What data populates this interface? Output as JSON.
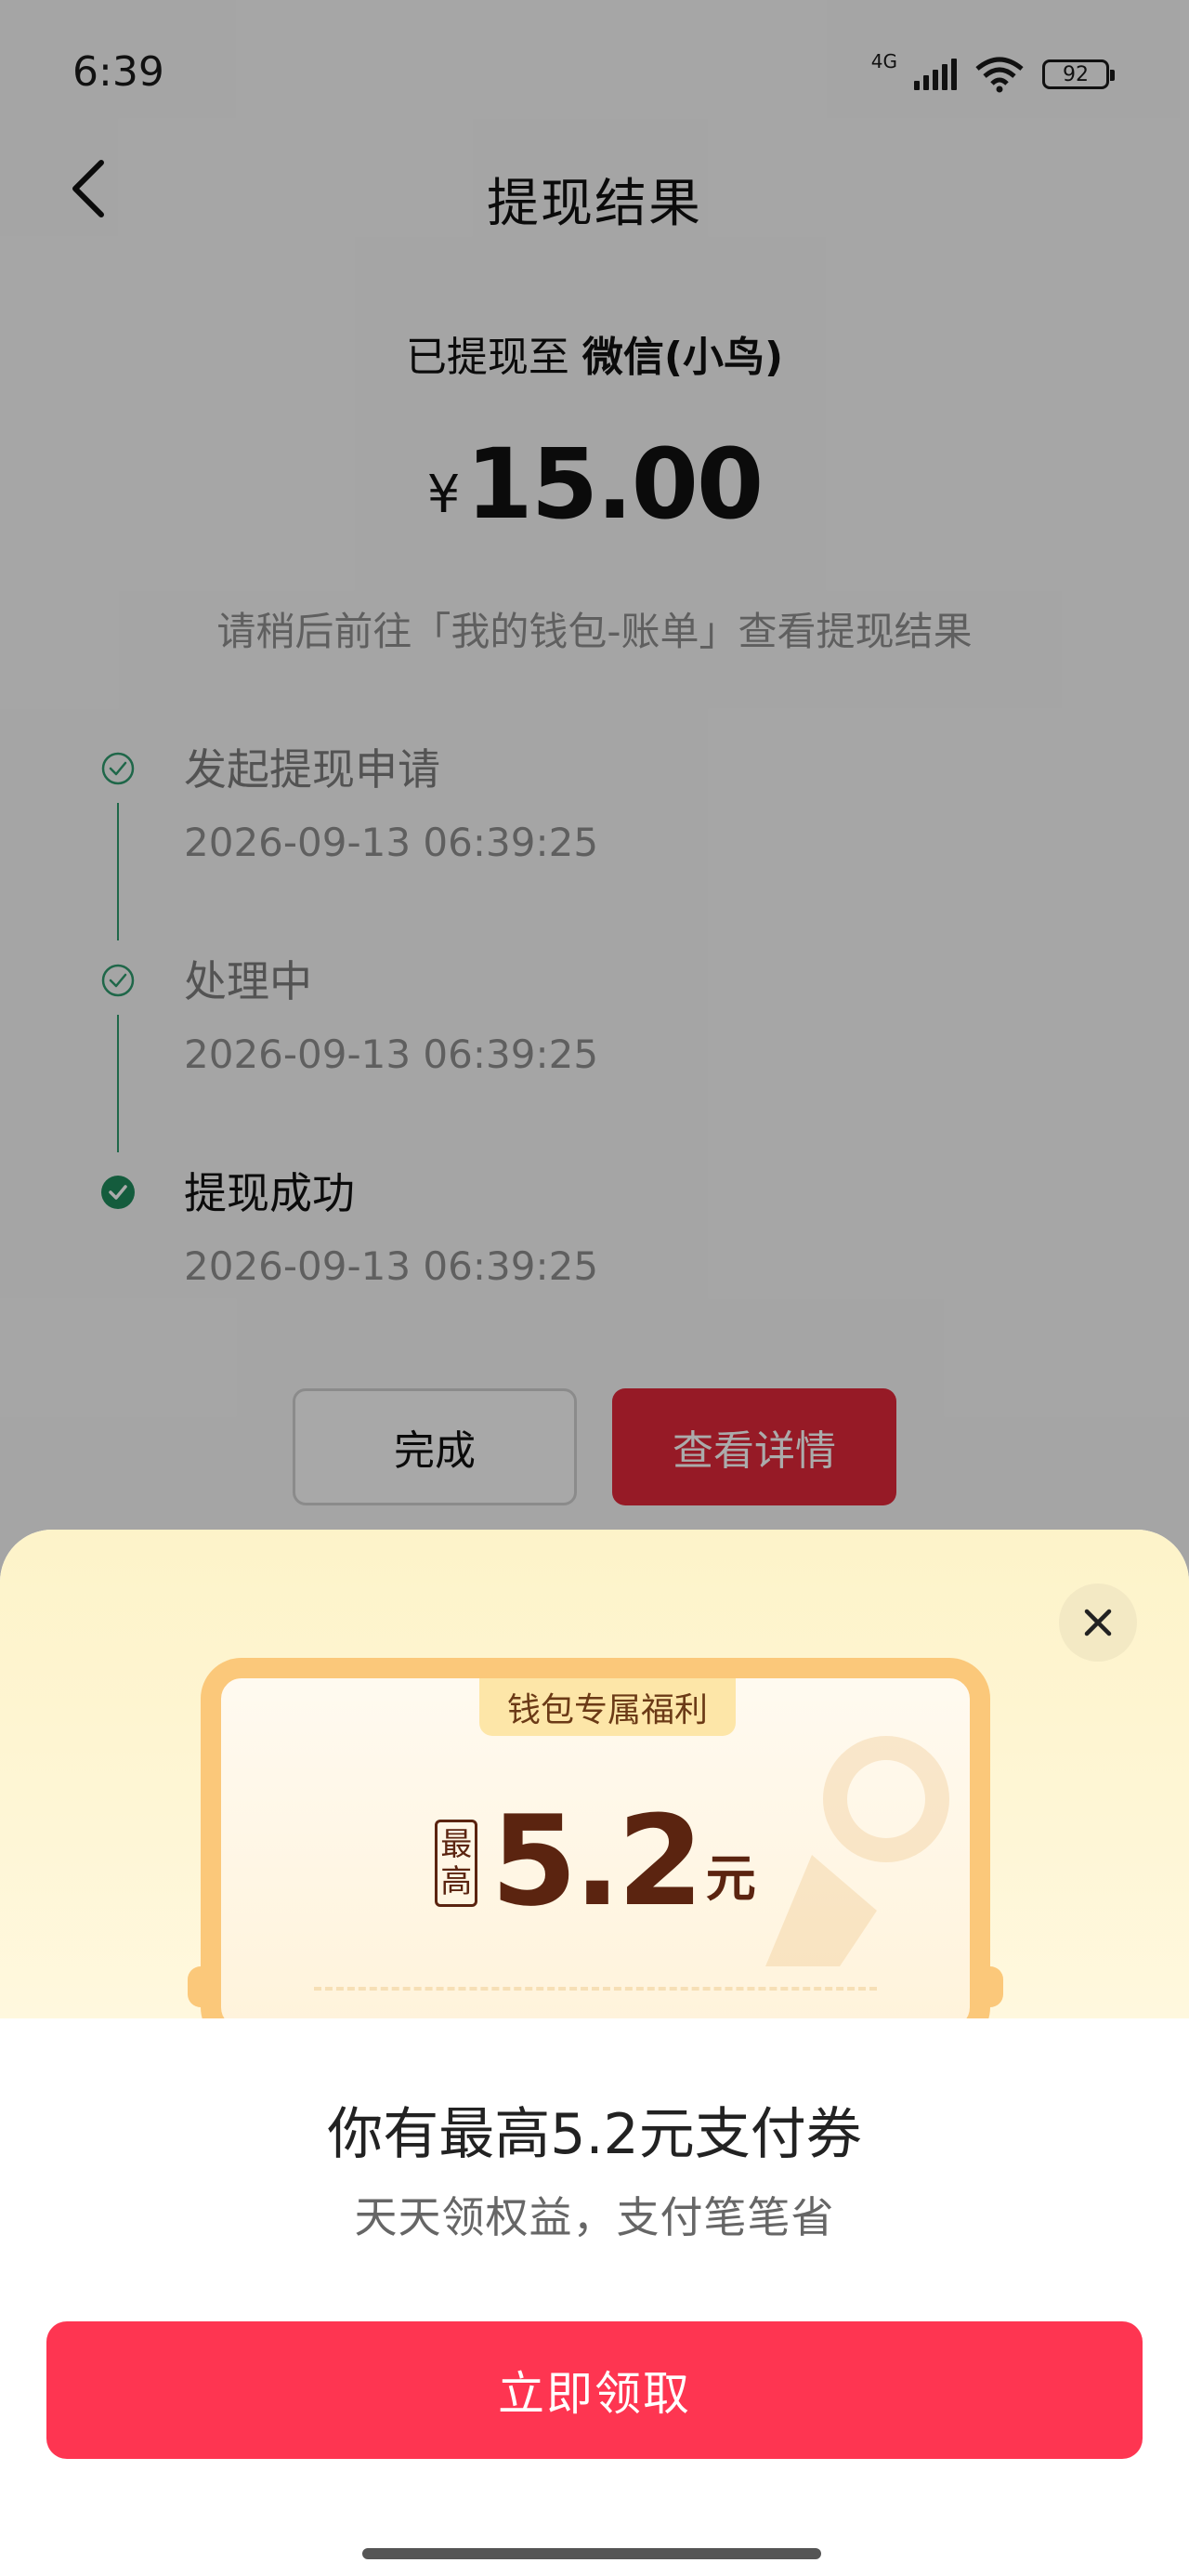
{
  "status_bar": {
    "time": "6:39",
    "network": "4G",
    "battery": "92"
  },
  "nav": {
    "title": "提现结果"
  },
  "result": {
    "dest_prefix": "已提现至",
    "dest_account": "微信(小鸟)",
    "currency": "¥",
    "amount": "15.00",
    "hint": "请稍后前往「我的钱包-账单」查看提现结果"
  },
  "steps": [
    {
      "title": "发起提现申请",
      "time": "2026-09-13 06:39:25"
    },
    {
      "title": "处理中",
      "time": "2026-09-13 06:39:25"
    },
    {
      "title": "提现成功",
      "time": "2026-09-13 06:39:25"
    }
  ],
  "buttons": {
    "done": "完成",
    "details": "查看详情"
  },
  "sheet": {
    "coupon_tag": "钱包专属福利",
    "badge_top": "最",
    "badge_bottom": "高",
    "coupon_value": "5.2",
    "coupon_unit": "元",
    "headline": "你有最高5.2元支付券",
    "subline": "天天领权益，支付笔笔省",
    "claim": "立即领取"
  },
  "colors": {
    "accent_green": "#2f9a6e",
    "primary_red": "#e0283a",
    "claim_pink": "#fe3551",
    "coupon_text": "#5b2410"
  }
}
